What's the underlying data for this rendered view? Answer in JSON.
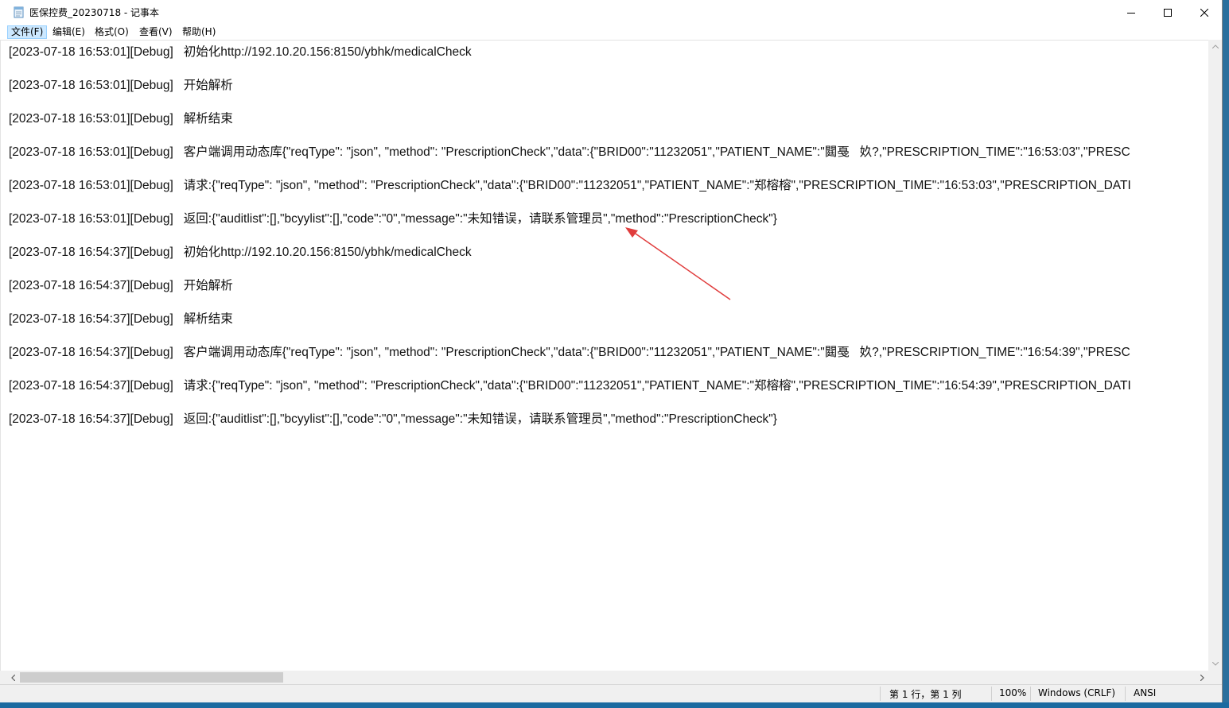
{
  "window": {
    "title": "医保控费_20230718 - 记事本",
    "minimize_icon": "minimize-icon",
    "maximize_icon": "maximize-icon",
    "close_icon": "close-icon"
  },
  "menu": [
    {
      "label": "文件(F)"
    },
    {
      "label": "编辑(E)"
    },
    {
      "label": "格式(O)"
    },
    {
      "label": "查看(V)"
    },
    {
      "label": "帮助(H)"
    }
  ],
  "lines": [
    {
      "text": "[2023-07-18 16:53:01][Debug]   初始化http://192.10.20.156:8150/ybhk/medicalCheck"
    },
    {
      "text": "[2023-07-18 16:53:01][Debug]   开始解析"
    },
    {
      "text": "[2023-07-18 16:53:01][Debug]   解析结束"
    },
    {
      "text": "[2023-07-18 16:53:01][Debug]   客户端调用动态库{\"reqType\": \"json\", \"method\": \"PrescriptionCheck\",\"data\":{\"BRID00\":\"11232051\",\"PATIENT_NAME\":\"閮戞   奺?,\"PRESCRIPTION_TIME\":\"16:53:03\",\"PRESC"
    },
    {
      "text": "[2023-07-18 16:53:01][Debug]   请求:{\"reqType\": \"json\", \"method\": \"PrescriptionCheck\",\"data\":{\"BRID00\":\"11232051\",\"PATIENT_NAME\":\"郑榕榕\",\"PRESCRIPTION_TIME\":\"16:53:03\",\"PRESCRIPTION_DATI"
    },
    {
      "text": "[2023-07-18 16:53:01][Debug]   返回:{\"auditlist\":[],\"bcyylist\":[],\"code\":\"0\",\"message\":\"未知错误，请联系管理员\",\"method\":\"PrescriptionCheck\"}"
    },
    {
      "text": "[2023-07-18 16:54:37][Debug]   初始化http://192.10.20.156:8150/ybhk/medicalCheck"
    },
    {
      "text": "[2023-07-18 16:54:37][Debug]   开始解析"
    },
    {
      "text": "[2023-07-18 16:54:37][Debug]   解析结束"
    },
    {
      "text": "[2023-07-18 16:54:37][Debug]   客户端调用动态库{\"reqType\": \"json\", \"method\": \"PrescriptionCheck\",\"data\":{\"BRID00\":\"11232051\",\"PATIENT_NAME\":\"閮戞   奺?,\"PRESCRIPTION_TIME\":\"16:54:39\",\"PRESC"
    },
    {
      "text": "[2023-07-18 16:54:37][Debug]   请求:{\"reqType\": \"json\", \"method\": \"PrescriptionCheck\",\"data\":{\"BRID00\":\"11232051\",\"PATIENT_NAME\":\"郑榕榕\",\"PRESCRIPTION_TIME\":\"16:54:39\",\"PRESCRIPTION_DATI"
    },
    {
      "text": "[2023-07-18 16:54:37][Debug]   返回:{\"auditlist\":[],\"bcyylist\":[],\"code\":\"0\",\"message\":\"未知错误，请联系管理员\",\"method\":\"PrescriptionCheck\"}"
    }
  ],
  "status": {
    "position": "第 1 行，第 1 列",
    "zoom": "100%",
    "line_ending": "Windows (CRLF)",
    "encoding": "ANSI"
  },
  "colors": {
    "annotation_arrow": "#e03c3c",
    "menu_highlight": "#cce8ff"
  }
}
